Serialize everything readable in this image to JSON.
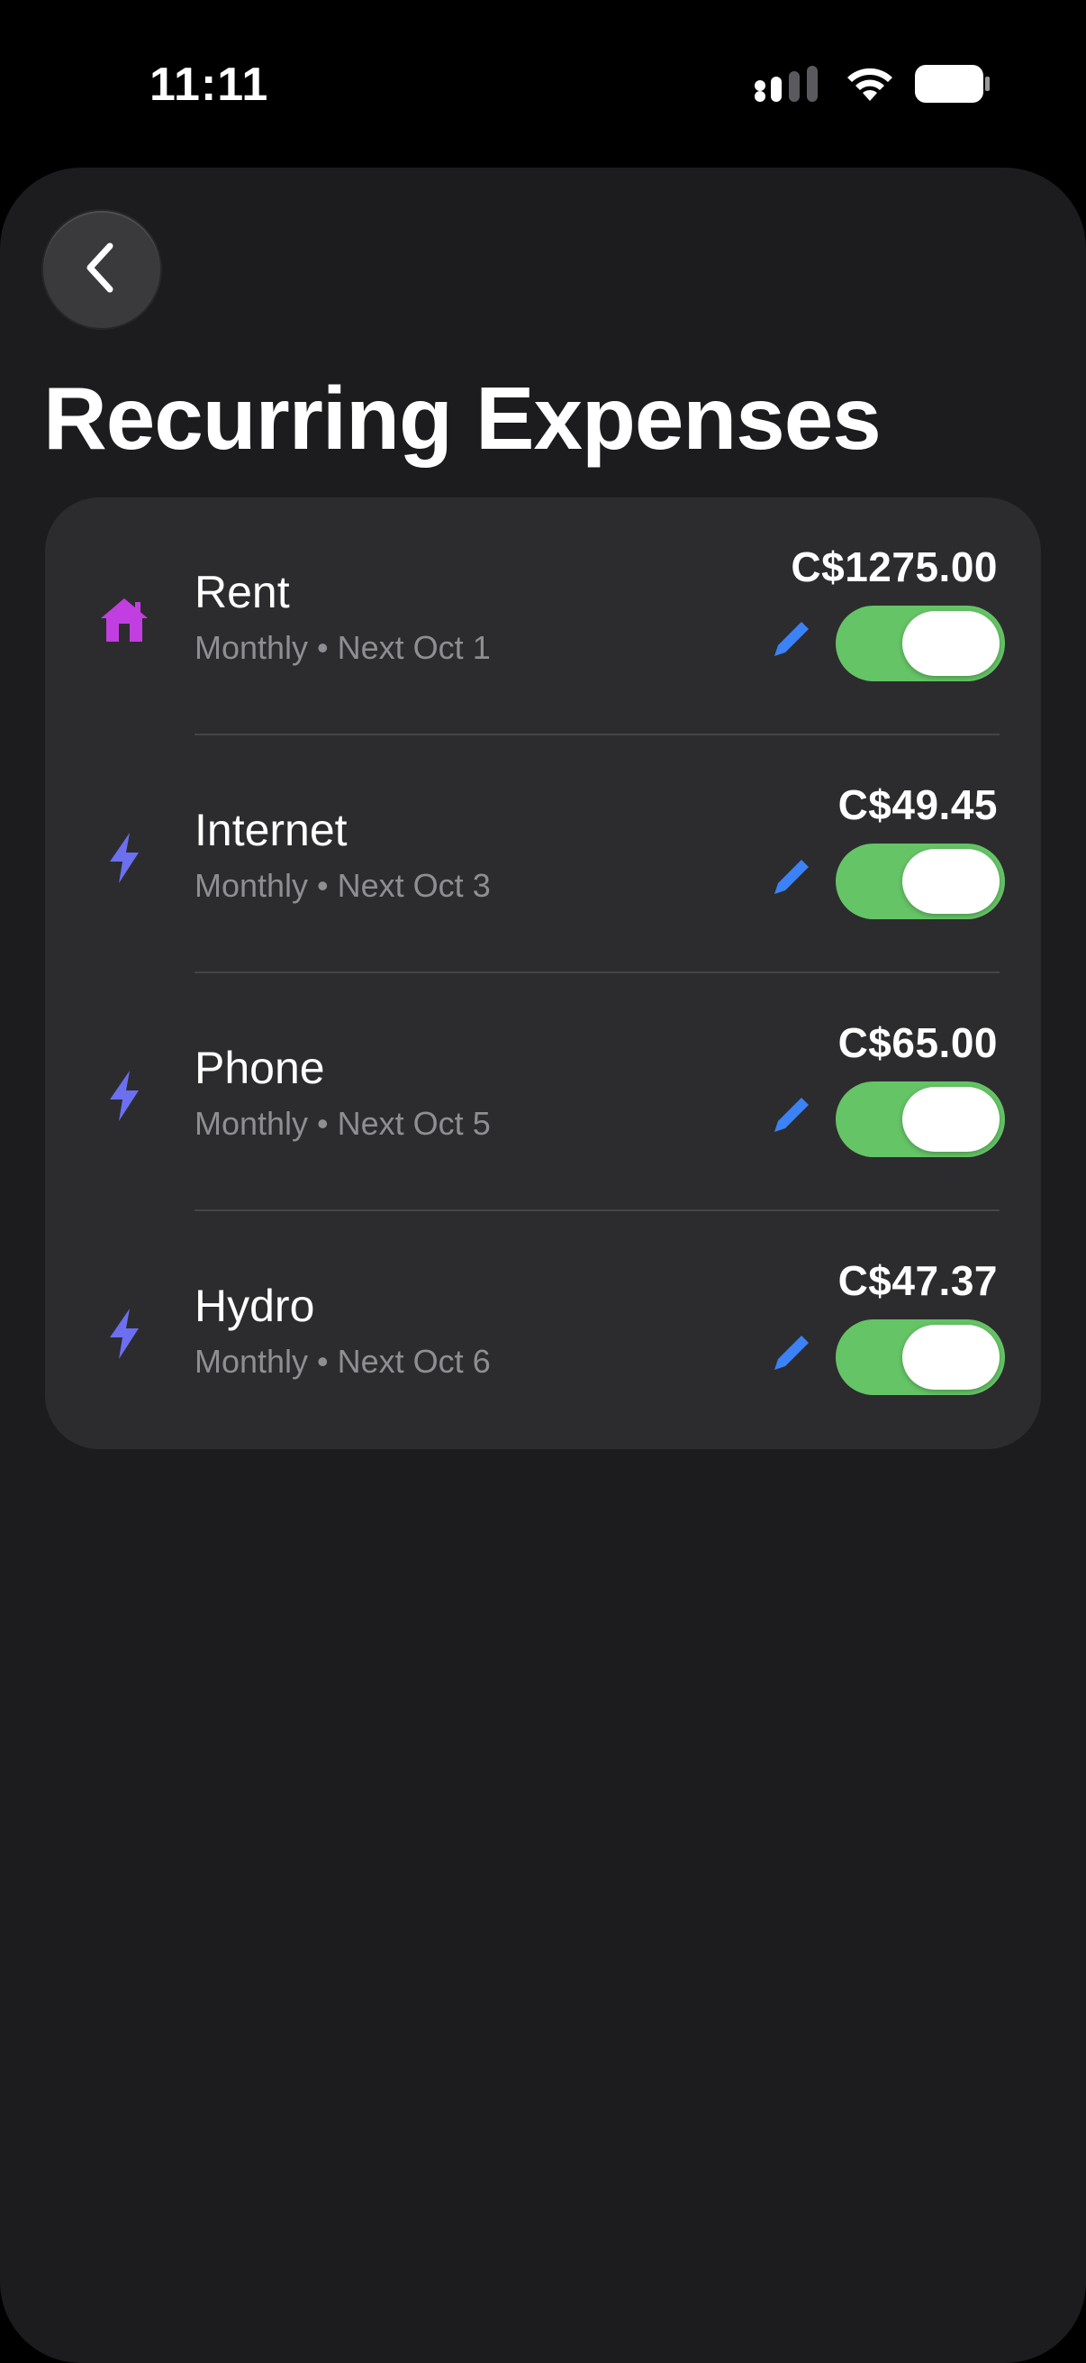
{
  "status_bar": {
    "time": "11:11"
  },
  "header": {
    "back_icon": "chevron-left-icon",
    "title": "Recurring Expenses"
  },
  "colors": {
    "background": "#1c1c1e",
    "card": "#2c2c2e",
    "toggle_on": "#65c466",
    "edit_icon": "#3b82f6",
    "home_icon": "#c13fe0",
    "bolt_icon": "#6b6ff0",
    "secondary_text": "#8e8e93"
  },
  "expenses": [
    {
      "icon": "home-icon",
      "name": "Rent",
      "meta": "Monthly • Next Oct 1",
      "amount": "C$1275.00",
      "enabled": true
    },
    {
      "icon": "bolt-icon",
      "name": "Internet",
      "meta": "Monthly • Next Oct 3",
      "amount": "C$49.45",
      "enabled": true
    },
    {
      "icon": "bolt-icon",
      "name": "Phone",
      "meta": "Monthly • Next Oct 5",
      "amount": "C$65.00",
      "enabled": true
    },
    {
      "icon": "bolt-icon",
      "name": "Hydro",
      "meta": "Monthly • Next Oct 6",
      "amount": "C$47.37",
      "enabled": true
    }
  ]
}
